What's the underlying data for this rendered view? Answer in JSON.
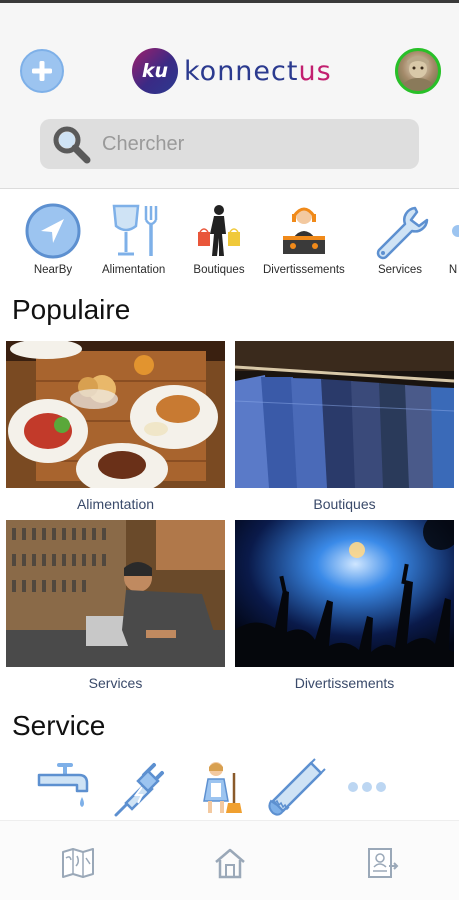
{
  "header": {
    "logo_mark": "ku",
    "brand_main": "konnect",
    "brand_accent": "us",
    "add_icon": "plus-circle-icon",
    "avatar_alt": "Profil"
  },
  "search": {
    "placeholder": "Chercher",
    "icon": "magnifier-icon"
  },
  "categories": [
    {
      "label": "NearBy",
      "icon": "location-arrow-icon"
    },
    {
      "label": "Alimentation",
      "icon": "glass-fork-icon"
    },
    {
      "label": "Boutiques",
      "icon": "shopper-icon"
    },
    {
      "label": "Divertissements",
      "icon": "dj-icon"
    },
    {
      "label": "Services",
      "icon": "wrench-icon"
    },
    {
      "label": "N",
      "icon": "partial-icon"
    }
  ],
  "popular": {
    "title": "Populaire",
    "tiles": [
      {
        "label": "Alimentation",
        "image": "food-plates-photo"
      },
      {
        "label": "Boutiques",
        "image": "clothes-rack-photo"
      },
      {
        "label": "Services",
        "image": "key-workshop-photo"
      },
      {
        "label": "Divertissements",
        "image": "concert-crowd-photo"
      }
    ]
  },
  "service": {
    "title": "Service",
    "items": [
      "faucet-icon",
      "electric-plug-icon",
      "cleaning-lady-icon",
      "saw-icon",
      "more-dots-icon"
    ]
  },
  "bottom_nav": [
    "map-icon",
    "home-icon",
    "profile-card-icon"
  ],
  "colors": {
    "brand_blue": "#2b3a8f",
    "brand_pink": "#c21f6f",
    "icon_blue": "#7eb0e8",
    "avatar_ring": "#28c028"
  }
}
